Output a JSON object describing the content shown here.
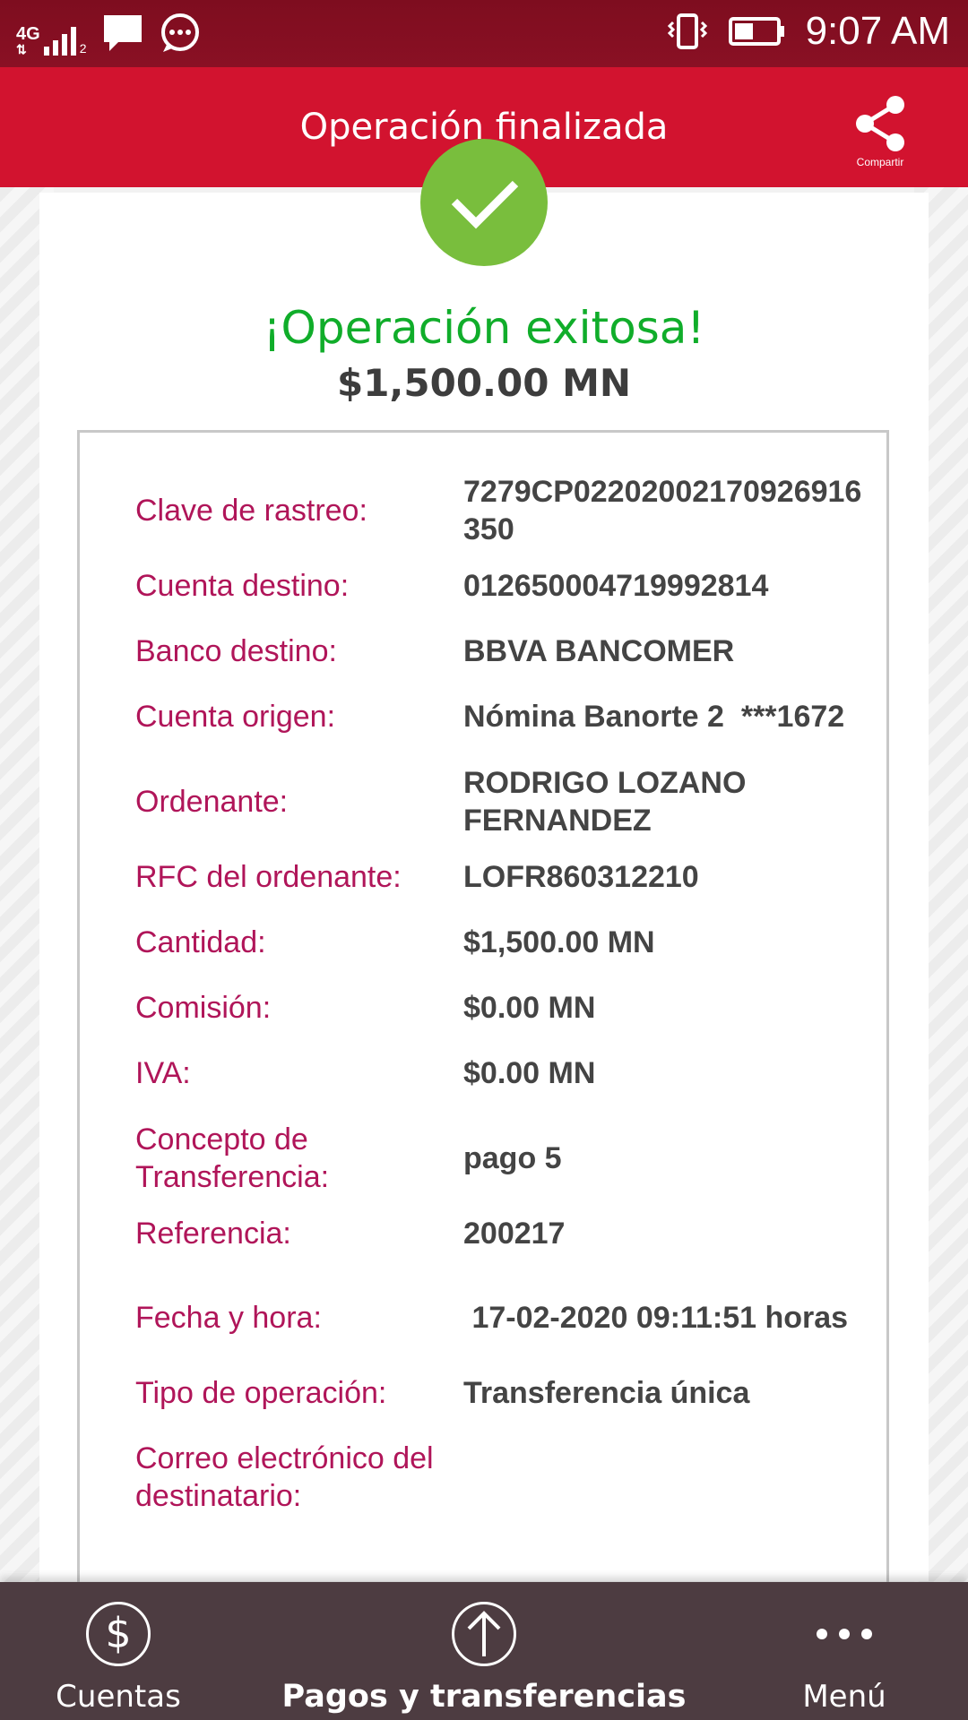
{
  "status_bar": {
    "network": "4G",
    "sim": "2",
    "time": "9:07 AM"
  },
  "header": {
    "title": "Operación finalizada",
    "share_label": "Compartir"
  },
  "result": {
    "message": "¡Operación exitosa!",
    "amount": "$1,500.00 MN"
  },
  "details": [
    {
      "label": "Clave de rastreo:",
      "value": "7279CP02202002170926916350"
    },
    {
      "label": "Cuenta destino:",
      "value": "012650004719992814"
    },
    {
      "label": "Banco destino:",
      "value": "BBVA BANCOMER"
    },
    {
      "label": "Cuenta origen:",
      "value": "Nómina Banorte 2  ***1672"
    },
    {
      "label": "Ordenante:",
      "value": "RODRIGO LOZANO FERNANDEZ"
    },
    {
      "label": "RFC del ordenante:",
      "value": "LOFR860312210"
    },
    {
      "label": "Cantidad:",
      "value": "$1,500.00 MN"
    },
    {
      "label": "Comisión:",
      "value": "$0.00 MN"
    },
    {
      "label": "IVA:",
      "value": "$0.00 MN"
    },
    {
      "label": "Concepto de Transferencia:",
      "value": "pago 5"
    },
    {
      "label": "Referencia:",
      "value": "200217"
    },
    {
      "label": "Fecha y hora:",
      "value": " 17-02-2020 09:11:51 horas"
    },
    {
      "label": "Tipo de operación:",
      "value": "Transferencia única"
    },
    {
      "label": "Correo electrónico del destinatario:",
      "value": ""
    }
  ],
  "bottom_nav": {
    "items": [
      {
        "label": "Cuentas",
        "icon": "dollar-circle-icon"
      },
      {
        "label": "Pagos y transferencias",
        "icon": "arrow-up-circle-icon",
        "active": true
      },
      {
        "label": "Menú",
        "icon": "more-dots-icon"
      }
    ]
  },
  "colors": {
    "header": "#d2132f",
    "success": "#10ad2a",
    "label": "#b01559",
    "nav": "#4d3c41"
  }
}
